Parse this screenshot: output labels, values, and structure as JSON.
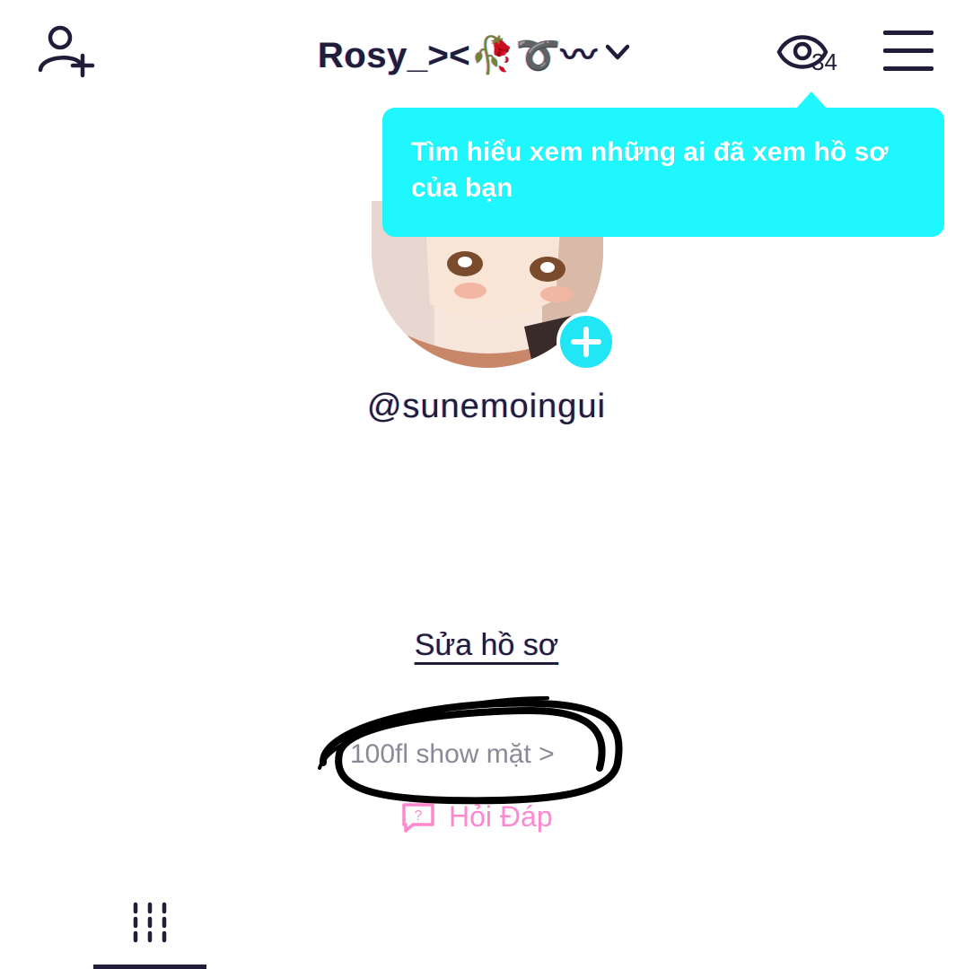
{
  "header": {
    "username": "Rosy_><🥀➰〰",
    "profile_views_count": "34"
  },
  "tooltip": {
    "text": "Tìm hiểu xem những ai đã xem hồ sơ của bạn"
  },
  "profile": {
    "handle": "@sunemoingui",
    "edit_profile_label": "Sửa hồ sơ",
    "bio": "100fl show mặt >"
  },
  "qa": {
    "label": "Hỏi Đáp"
  },
  "icons": {
    "add_user": "add-user-icon",
    "chevron": "chevron-down-icon",
    "eye": "eye-icon",
    "menu": "menu-icon",
    "plus": "plus-icon",
    "qa": "question-bubble-icon",
    "grid": "grid-icon"
  },
  "colors": {
    "accent": "#1ff7ff",
    "text": "#1f1d3a",
    "qa": "#ff5fbf"
  }
}
